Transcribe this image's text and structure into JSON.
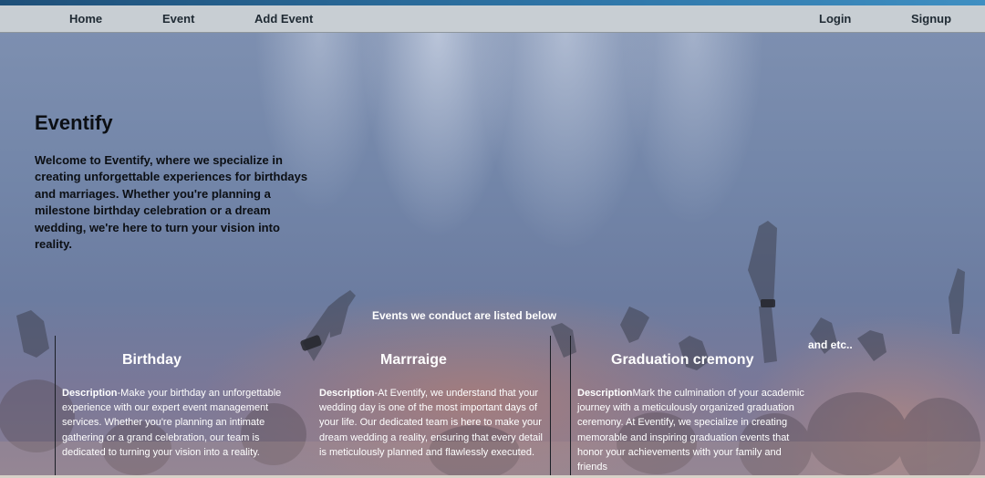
{
  "nav": {
    "home": "Home",
    "event": "Event",
    "add_event": "Add Event",
    "login": "Login",
    "signup": "Signup"
  },
  "hero": {
    "title": "Eventify",
    "intro": "Welcome to Eventify, where we specialize in creating unforgettable experiences for birthdays and marriages. Whether you're planning a milestone birthday celebration or a dream wedding, we're here to turn your vision into reality."
  },
  "events": {
    "caption": "Events we conduct are listed below",
    "and_etc": "and etc..",
    "description_label": "Description",
    "cards": [
      {
        "title": "Birthday",
        "label": "Description",
        "text": "-Make your birthday an unforgettable experience with our expert event management services. Whether you're planning an intimate gathering or a grand celebration, our team is dedicated to turning your vision into a reality."
      },
      {
        "title": "Marrraige",
        "label": "Description",
        "text": "-At Eventify, we understand that your wedding day is one of the most important days of your life. Our dedicated team is here to make your dream wedding a reality, ensuring that every detail is meticulously planned and flawlessly executed."
      },
      {
        "title": "Graduation cremony",
        "label": "Description",
        "text": "Mark the culmination of your academic journey with a meticulously organized graduation ceremony. At Eventify, we specialize in creating memorable and inspiring graduation events that honor your achievements with your family and friends"
      }
    ]
  },
  "colors": {
    "navbar_bg": "#c8ced3",
    "accent_bar": "#2f76a8",
    "hero_overlay": "#7285a8"
  }
}
